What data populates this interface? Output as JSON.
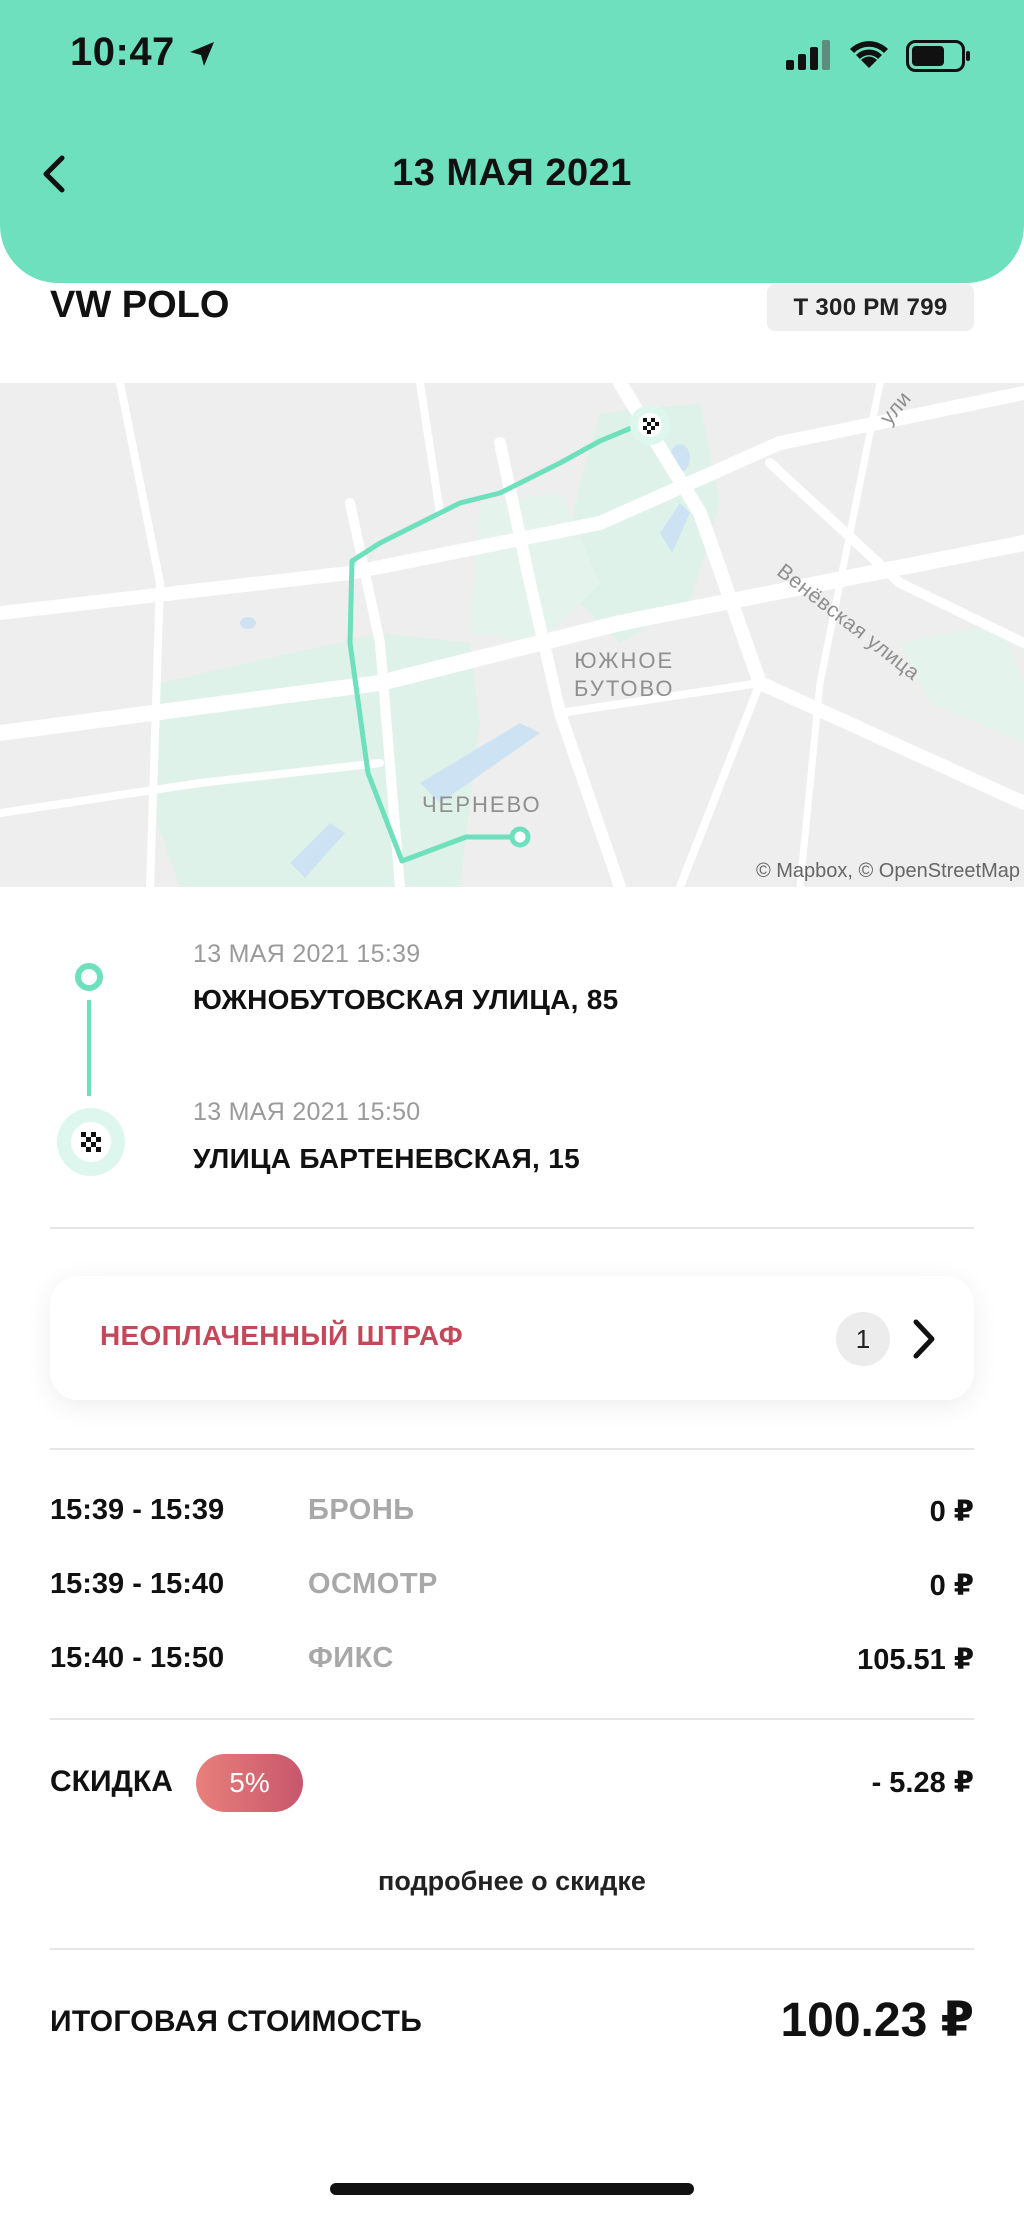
{
  "status_bar": {
    "time": "10:47"
  },
  "header": {
    "title": "13 МАЯ 2021"
  },
  "car": {
    "name": "VW POLO",
    "plate": "Т 300 РМ 799"
  },
  "map": {
    "labels": {
      "district_line1": "ЮЖНОЕ",
      "district_line2": "БУТОВО",
      "village": "ЧЕРНЕВО",
      "street": "Венёвская улица",
      "street_cut": "ули"
    },
    "attribution": "© Mapbox, © OpenStreetMap",
    "route_color": "#6ee0bd"
  },
  "route": {
    "start": {
      "time": "13 МАЯ 2021 15:39",
      "address": "ЮЖНОБУТОВСКАЯ УЛИЦА, 85"
    },
    "end": {
      "time": "13 МАЯ 2021 15:50",
      "address": "УЛИЦА БАРТЕНЕВСКАЯ, 15"
    }
  },
  "fine": {
    "label": "НЕОПЛАЧЕННЫЙ ШТРАФ",
    "count": "1"
  },
  "tariffs": [
    {
      "time": "15:39 - 15:39",
      "type": "БРОНЬ",
      "price": "0 ₽"
    },
    {
      "time": "15:39 - 15:40",
      "type": "ОСМОТР",
      "price": "0 ₽"
    },
    {
      "time": "15:40 - 15:50",
      "type": "ФИКС",
      "price": "105.51 ₽"
    }
  ],
  "discount": {
    "label": "СКИДКА",
    "percent": "5%",
    "amount": "- 5.28 ₽",
    "more_link": "подробнее о скидке"
  },
  "total": {
    "label": "ИТОГОВАЯ СТОИМОСТЬ",
    "value": "100.23 ₽"
  },
  "colors": {
    "accent": "#6ee0bd",
    "fine": "#c4475a",
    "discount_from": "#e8807c",
    "discount_to": "#c7566c"
  }
}
